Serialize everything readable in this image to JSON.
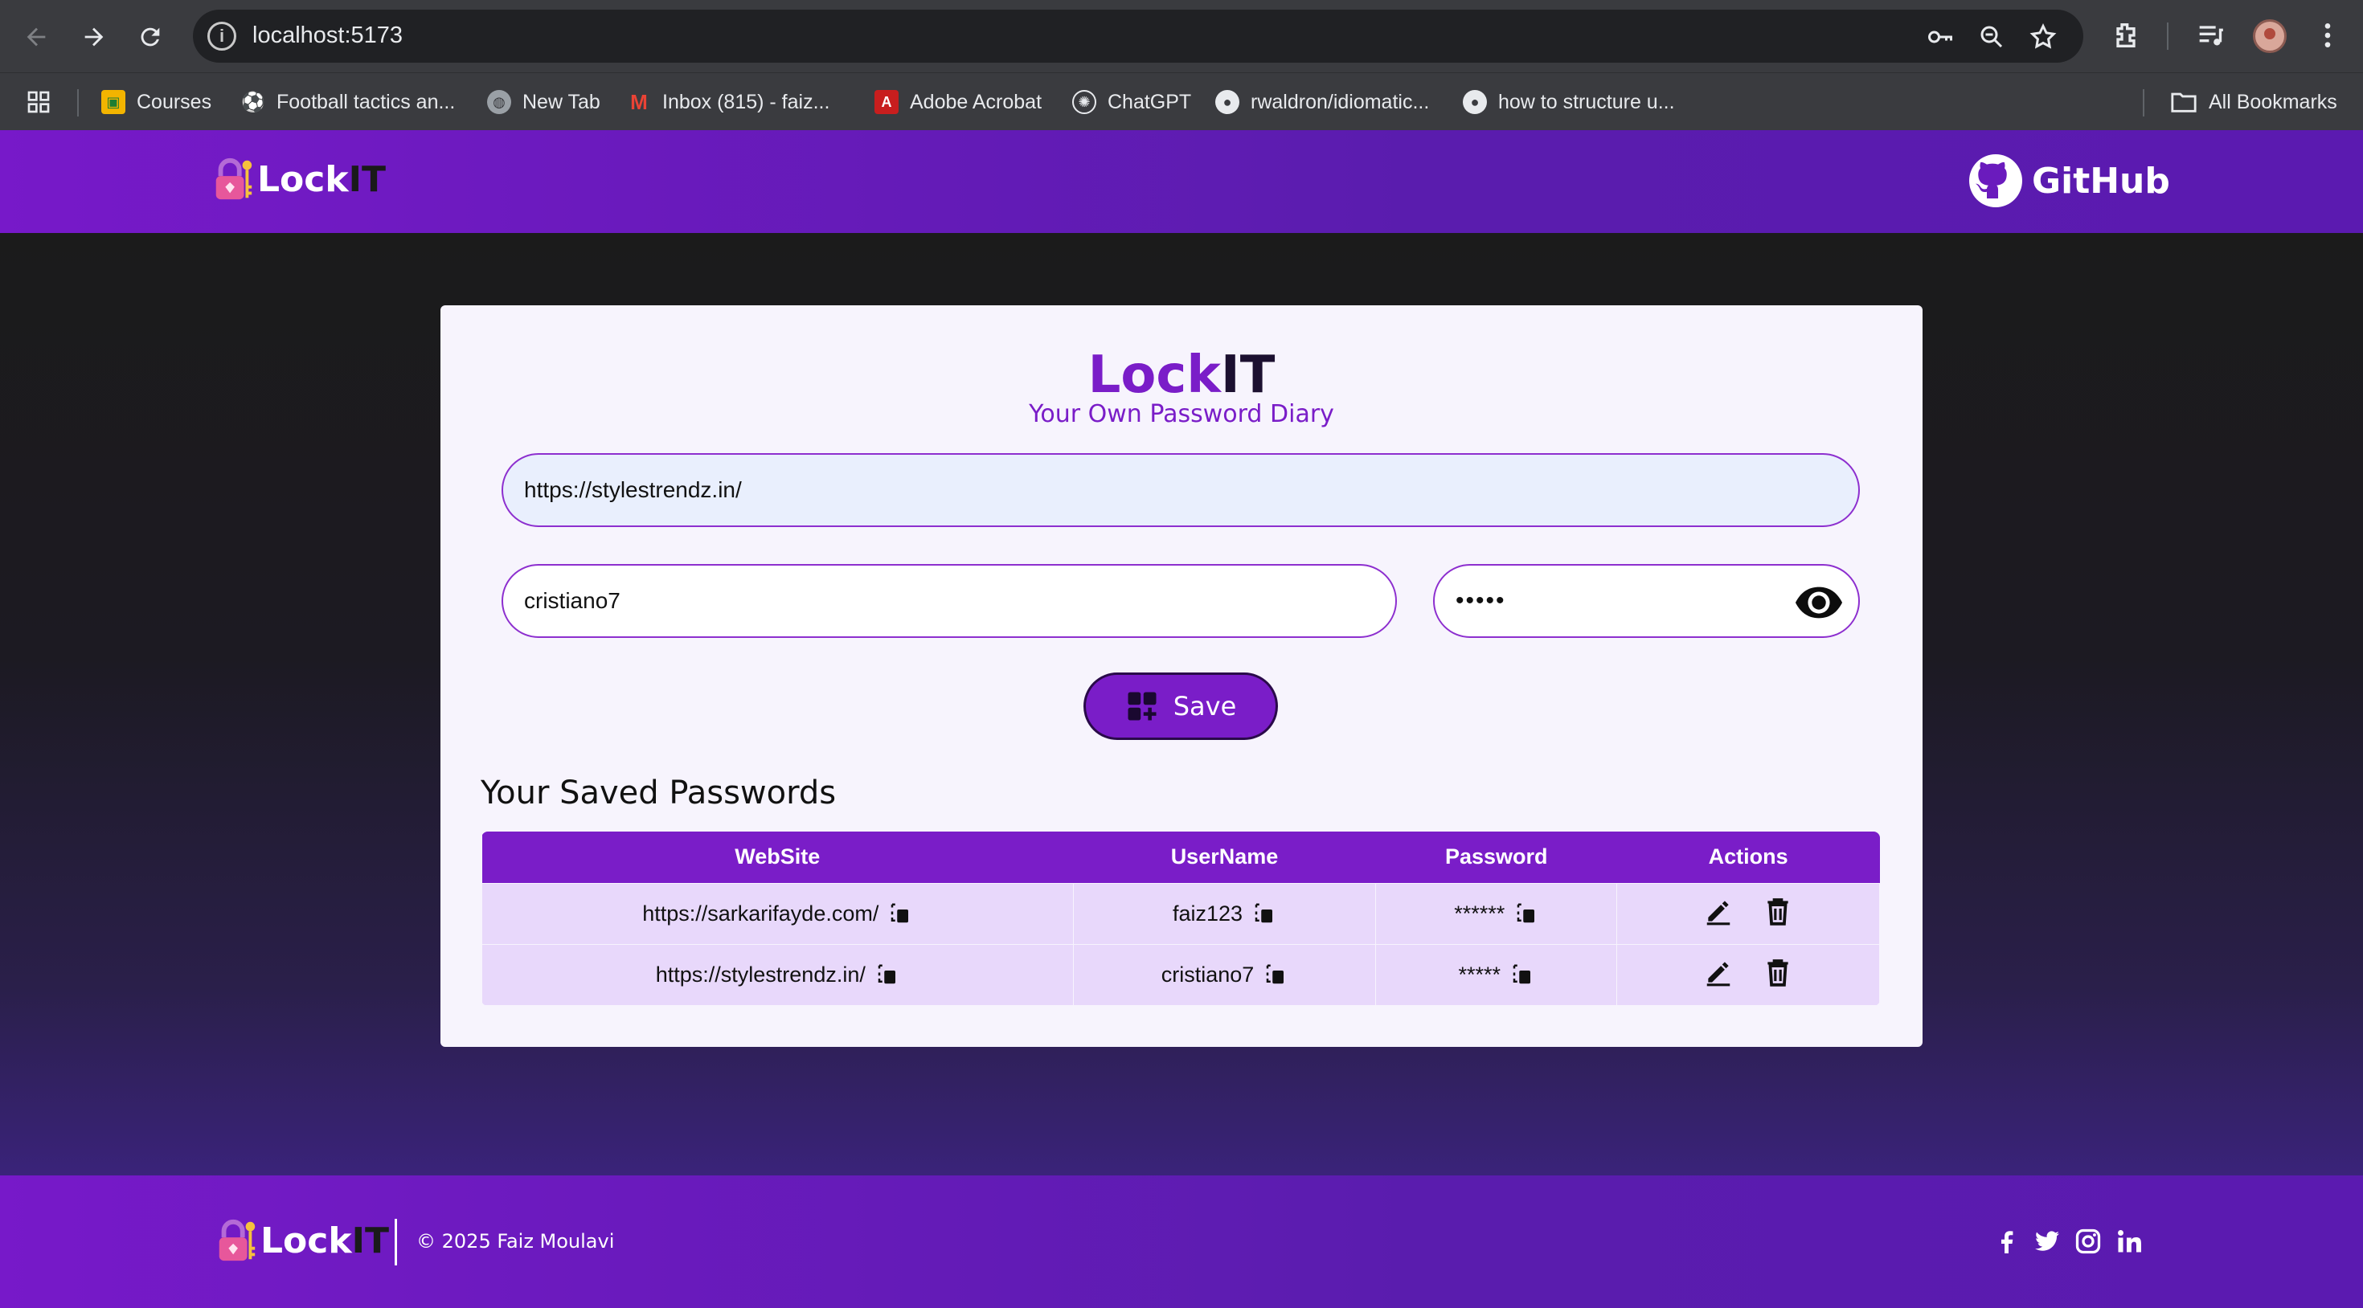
{
  "browser": {
    "url": "localhost:5173",
    "bookmarks": [
      {
        "label": "Courses",
        "icon": "classroom-icon"
      },
      {
        "label": "Football tactics an...",
        "icon": "football-icon"
      },
      {
        "label": "New Tab",
        "icon": "globe-icon"
      },
      {
        "label": "Inbox (815) - faiz...",
        "icon": "gmail-icon"
      },
      {
        "label": "Adobe Acrobat",
        "icon": "acrobat-icon"
      },
      {
        "label": "ChatGPT",
        "icon": "chatgpt-icon"
      },
      {
        "label": "rwaldron/idiomatic...",
        "icon": "github-icon"
      },
      {
        "label": "how to structure u...",
        "icon": "github-icon"
      }
    ],
    "all_bookmarks": "All Bookmarks"
  },
  "header": {
    "logo_main": "Lock",
    "logo_accent": "IT",
    "github_label": "GitHub"
  },
  "card": {
    "title_main": "Lock",
    "title_accent": "IT",
    "subtitle": "Your Own Password Diary",
    "url_value": "https://stylestrendz.in/",
    "username_value": "cristiano7",
    "password_value": "•••••",
    "save_label": "Save",
    "saved_title": "Your Saved Passwords"
  },
  "table": {
    "headers": [
      "WebSite",
      "UserName",
      "Password",
      "Actions"
    ],
    "rows": [
      {
        "site": "https://sarkarifayde.com/",
        "user": "faiz123",
        "pass": "******"
      },
      {
        "site": "https://stylestrendz.in/",
        "user": "cristiano7",
        "pass": "*****"
      }
    ]
  },
  "footer": {
    "logo_main": "Lock",
    "logo_accent": "IT",
    "copyright": "© 2025 Faiz Moulavi",
    "social": [
      "facebook-icon",
      "twitter-icon",
      "instagram-icon",
      "linkedin-icon"
    ]
  },
  "colors": {
    "brand_purple": "#7a1dc8",
    "header_gradient_end": "#5b1ab0",
    "row_bg": "#e8d8fb",
    "url_field_bg": "#e9effd"
  }
}
